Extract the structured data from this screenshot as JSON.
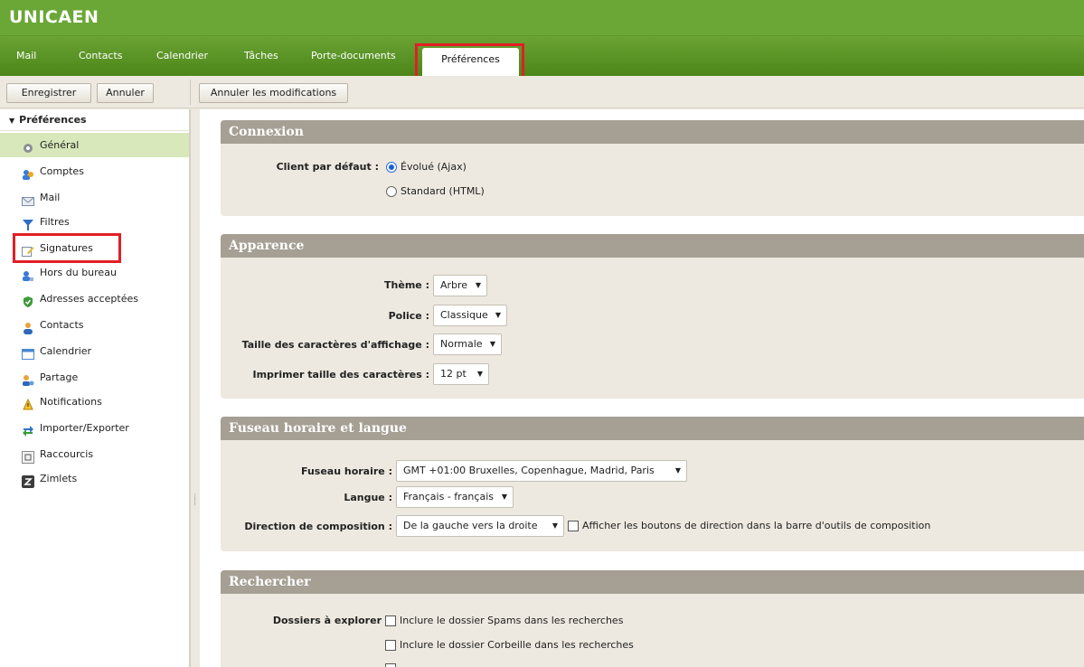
{
  "header": {
    "logo": "UNICAEN"
  },
  "tabs": [
    {
      "label": "Mail"
    },
    {
      "label": "Contacts"
    },
    {
      "label": "Calendrier"
    },
    {
      "label": "Tâches"
    },
    {
      "label": "Porte-documents"
    },
    {
      "label": "Préférences",
      "active": true
    }
  ],
  "toolbar": {
    "save_label": "Enregistrer",
    "cancel_label": "Annuler",
    "undo_label": "Annuler les modifications"
  },
  "sidebar": {
    "header": "Préférences",
    "items": [
      {
        "label": "Général",
        "icon": "gear-icon",
        "selected": true
      },
      {
        "label": "Comptes",
        "icon": "accounts-icon"
      },
      {
        "label": "Mail",
        "icon": "envelope-icon"
      },
      {
        "label": "Filtres",
        "icon": "filter-icon"
      },
      {
        "label": "Signatures",
        "icon": "signature-pen-icon"
      },
      {
        "label": "Hors du bureau",
        "icon": "out-of-office-icon"
      },
      {
        "label": "Adresses acceptées",
        "icon": "shield-check-icon"
      },
      {
        "label": "Contacts",
        "icon": "contact-person-icon"
      },
      {
        "label": "Calendrier",
        "icon": "calendar-icon"
      },
      {
        "label": "Partage",
        "icon": "sharing-icon"
      },
      {
        "label": "Notifications",
        "icon": "bell-icon"
      },
      {
        "label": "Importer/Exporter",
        "icon": "import-export-icon"
      },
      {
        "label": "Raccourcis",
        "icon": "keyboard-shortcut-icon"
      },
      {
        "label": "Zimlets",
        "icon": "zimlet-icon"
      }
    ]
  },
  "sections": {
    "connexion": {
      "title": "Connexion",
      "client_label": "Client par défaut :",
      "option_advanced": "Évolué (Ajax)",
      "option_standard": "Standard (HTML)"
    },
    "apparence": {
      "title": "Apparence",
      "theme_label": "Thème :",
      "theme_value": "Arbre",
      "font_label": "Police :",
      "font_value": "Classique",
      "size_label": "Taille des caractères d'affichage :",
      "size_value": "Normale",
      "print_label": "Imprimer taille des caractères :",
      "print_value": "12 pt"
    },
    "fuseau": {
      "title": "Fuseau horaire et langue",
      "tz_label": "Fuseau horaire :",
      "tz_value": "GMT +01:00 Bruxelles, Copenhague, Madrid, Paris",
      "lang_label": "Langue :",
      "lang_value": "Français - français",
      "dir_label": "Direction de composition :",
      "dir_value": "De la gauche vers la droite",
      "dir_checkbox": "Afficher les boutons de direction dans la barre d'outils de composition"
    },
    "rechercher": {
      "title": "Rechercher",
      "folders_label": "Dossiers à explorer",
      "opt_spam": "Inclure le dossier Spams dans les recherches",
      "opt_trash": "Inclure le dossier Corbeille dans les recherches"
    }
  },
  "colors": {
    "brand_green": "#6aa736",
    "highlight_red": "#e21e26",
    "section_header": "#a59f94"
  }
}
